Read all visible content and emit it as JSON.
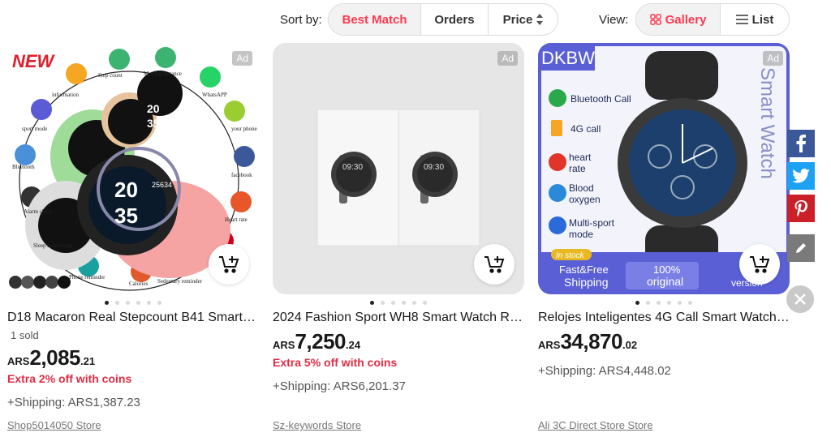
{
  "toolbar": {
    "sort_label": "Sort by:",
    "sort_options": [
      "Best Match",
      "Orders",
      "Price"
    ],
    "sort_active": "Best Match",
    "view_label": "View:",
    "view_options": [
      "Gallery",
      "List"
    ],
    "view_active": "Gallery"
  },
  "products": [
    {
      "title": "D18 Macaron Real Stepcount B41 Smart W...",
      "sold": "1 sold",
      "currency": "ARS",
      "price_int": "2,085",
      "price_dec": ".21",
      "coins": "Extra 2% off with coins",
      "shipping": "+Shipping: ARS1,387.23",
      "store": "Shop5014050 Store",
      "ad": "Ad",
      "image_badge": "NEW",
      "image_labels": [
        "Step count",
        "Moving distance",
        "information",
        "WhatsAPP",
        "sport mode",
        "your phone",
        "Bluetooth",
        "facebook",
        "Alarm clock",
        "Heart rate",
        "Sleep monitoring",
        "Phone reminder",
        "Calories",
        "Sedentary reminder"
      ],
      "watch_face": [
        "20",
        "25634",
        "35"
      ]
    },
    {
      "title": "2024 Fashion Sport WH8 Smart Watch Rou...",
      "currency": "ARS",
      "price_int": "7,250",
      "price_dec": ".24",
      "coins": "Extra 5% off with coins",
      "shipping": "+Shipping: ARS6,201.37",
      "store": "Sz-keywords Store",
      "ad": "Ad",
      "watch_time": "09:30"
    },
    {
      "title": "Relojes Inteligentes 4G Call Smart Watch f...",
      "currency": "ARS",
      "price_int": "34,870",
      "price_dec": ".02",
      "shipping": "+Shipping: ARS4,448.02",
      "store": "Ali 3C Direct Store Store",
      "ad": "Ad",
      "brand": "DKBW",
      "side_text": "Smart Watch",
      "features": [
        "Bluetooth Call",
        "4G call",
        "heart rate",
        "Blood oxygen",
        "Multi-sport mode"
      ],
      "badges": [
        "In stock",
        "Fast&Free Shipping",
        "100% original",
        "version"
      ]
    }
  ],
  "share_icons": [
    "facebook-icon",
    "twitter-icon",
    "pinterest-icon",
    "edit-icon",
    "close-icon"
  ],
  "colors": {
    "accent": "#fd384f",
    "coins": "#e32b44",
    "facebook": "#3b5998",
    "twitter": "#1da1f2",
    "pinterest": "#cb2027"
  }
}
